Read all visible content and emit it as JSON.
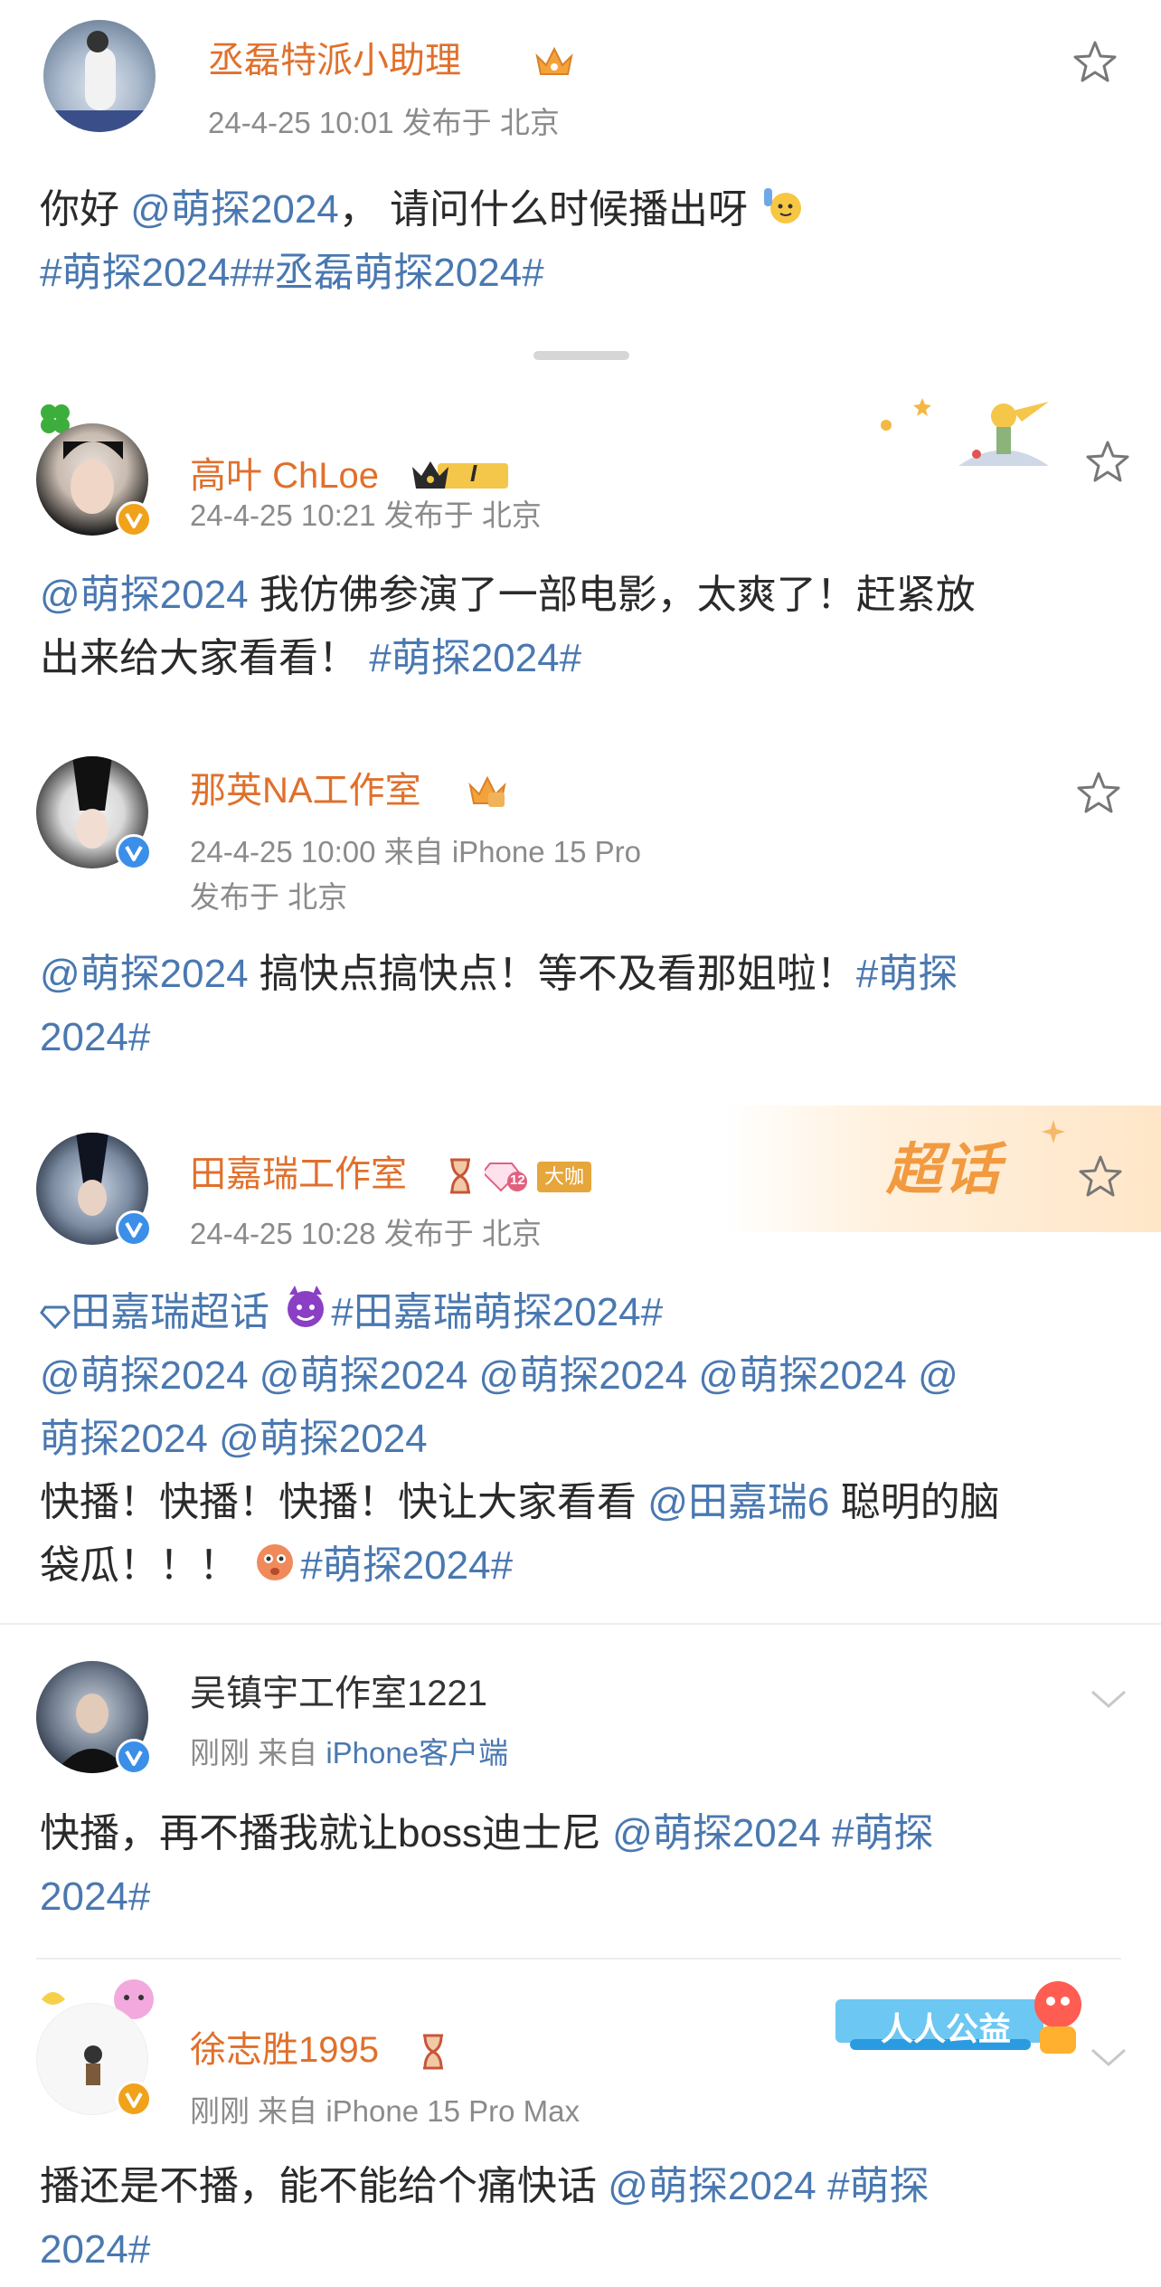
{
  "colors": {
    "accent_orange": "#e0702c",
    "link_blue": "#4a78b0",
    "meta_gray": "#8b8b8b",
    "verified_blue": "#3b8fe8",
    "verified_gold": "#f1a21b"
  },
  "posts": [
    {
      "name": "丞磊特派小助理",
      "crown_icon": "crown-icon",
      "meta": "24-4-25 10:01   发布于 北京",
      "text_a": "你好 ",
      "mention": "@萌探2024",
      "text_b": "， 请问什么时候播出呀",
      "emoji": "raised-hand-emoji",
      "hashtags": "#萌探2024##丞磊萌探2024#"
    },
    {
      "name": "高叶 ChLoe",
      "crown_badge": "I",
      "meta": "24-4-25 10:21  发布于 北京",
      "mention": "@萌探2024",
      "text_a": " 我仿佛参演了一部电影，太爽了！赶紧放",
      "text_b": "出来给大家看看！",
      "hashtag": "#萌探2024#"
    },
    {
      "name": "那英NA工作室",
      "meta_1": "24-4-25 10:00  来自 iPhone 15 Pro",
      "meta_2": "发布于 北京",
      "mention": "@萌探2024",
      "text_a": " 搞快点搞快点！等不及看那姐啦！",
      "hashtag_a": "#萌探",
      "hashtag_b": "2024#"
    },
    {
      "name": "田嘉瑞工作室",
      "badge_level": "12",
      "badge_label": "大咖",
      "super_topic_label": "超话",
      "meta": "24-4-25 10:28  发布于 北京",
      "topic_link": "田嘉瑞超话",
      "hashtag_1": "#田嘉瑞萌探2024#",
      "mentions_line": " @萌探2024 @萌探2024 @萌探2024 @萌探2024 @",
      "mentions_line_2": "萌探2024 @萌探2024",
      "text_a": "快播！快播！快播！快让大家看看 ",
      "mention_2": "@田嘉瑞6",
      "text_b": " 聪明的脑",
      "text_c": "袋瓜！！！ ",
      "hashtag_2": "#萌探2024#"
    },
    {
      "name": "吴镇宇工作室1221",
      "meta": "刚刚  来自 ",
      "meta_link": "iPhone客户端",
      "text_a": "快播，再不播我就让boss迪士尼 ",
      "mention": "@萌探2024",
      "hashtag_a": " #萌探",
      "hashtag_b": "2024#"
    },
    {
      "name": "徐志胜1995",
      "charity_label": "人人公益",
      "meta": "刚刚  来自 iPhone 15 Pro Max",
      "text_a": "播还是不播，能不能给个痛快话 ",
      "mention": "@萌探2024",
      "hashtag_a": " #萌探",
      "hashtag_b": "2024#"
    }
  ]
}
